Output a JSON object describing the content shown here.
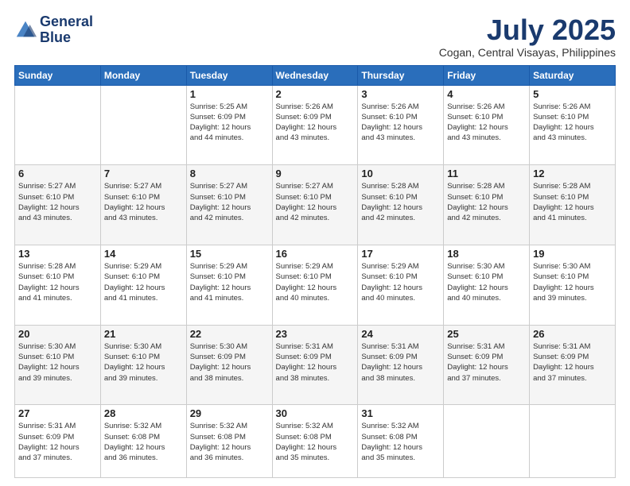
{
  "header": {
    "logo_line1": "General",
    "logo_line2": "Blue",
    "month_year": "July 2025",
    "location": "Cogan, Central Visayas, Philippines"
  },
  "days_of_week": [
    "Sunday",
    "Monday",
    "Tuesday",
    "Wednesday",
    "Thursday",
    "Friday",
    "Saturday"
  ],
  "weeks": [
    [
      {
        "num": "",
        "info": ""
      },
      {
        "num": "",
        "info": ""
      },
      {
        "num": "1",
        "info": "Sunrise: 5:25 AM\nSunset: 6:09 PM\nDaylight: 12 hours\nand 44 minutes."
      },
      {
        "num": "2",
        "info": "Sunrise: 5:26 AM\nSunset: 6:09 PM\nDaylight: 12 hours\nand 43 minutes."
      },
      {
        "num": "3",
        "info": "Sunrise: 5:26 AM\nSunset: 6:10 PM\nDaylight: 12 hours\nand 43 minutes."
      },
      {
        "num": "4",
        "info": "Sunrise: 5:26 AM\nSunset: 6:10 PM\nDaylight: 12 hours\nand 43 minutes."
      },
      {
        "num": "5",
        "info": "Sunrise: 5:26 AM\nSunset: 6:10 PM\nDaylight: 12 hours\nand 43 minutes."
      }
    ],
    [
      {
        "num": "6",
        "info": "Sunrise: 5:27 AM\nSunset: 6:10 PM\nDaylight: 12 hours\nand 43 minutes."
      },
      {
        "num": "7",
        "info": "Sunrise: 5:27 AM\nSunset: 6:10 PM\nDaylight: 12 hours\nand 43 minutes."
      },
      {
        "num": "8",
        "info": "Sunrise: 5:27 AM\nSunset: 6:10 PM\nDaylight: 12 hours\nand 42 minutes."
      },
      {
        "num": "9",
        "info": "Sunrise: 5:27 AM\nSunset: 6:10 PM\nDaylight: 12 hours\nand 42 minutes."
      },
      {
        "num": "10",
        "info": "Sunrise: 5:28 AM\nSunset: 6:10 PM\nDaylight: 12 hours\nand 42 minutes."
      },
      {
        "num": "11",
        "info": "Sunrise: 5:28 AM\nSunset: 6:10 PM\nDaylight: 12 hours\nand 42 minutes."
      },
      {
        "num": "12",
        "info": "Sunrise: 5:28 AM\nSunset: 6:10 PM\nDaylight: 12 hours\nand 41 minutes."
      }
    ],
    [
      {
        "num": "13",
        "info": "Sunrise: 5:28 AM\nSunset: 6:10 PM\nDaylight: 12 hours\nand 41 minutes."
      },
      {
        "num": "14",
        "info": "Sunrise: 5:29 AM\nSunset: 6:10 PM\nDaylight: 12 hours\nand 41 minutes."
      },
      {
        "num": "15",
        "info": "Sunrise: 5:29 AM\nSunset: 6:10 PM\nDaylight: 12 hours\nand 41 minutes."
      },
      {
        "num": "16",
        "info": "Sunrise: 5:29 AM\nSunset: 6:10 PM\nDaylight: 12 hours\nand 40 minutes."
      },
      {
        "num": "17",
        "info": "Sunrise: 5:29 AM\nSunset: 6:10 PM\nDaylight: 12 hours\nand 40 minutes."
      },
      {
        "num": "18",
        "info": "Sunrise: 5:30 AM\nSunset: 6:10 PM\nDaylight: 12 hours\nand 40 minutes."
      },
      {
        "num": "19",
        "info": "Sunrise: 5:30 AM\nSunset: 6:10 PM\nDaylight: 12 hours\nand 39 minutes."
      }
    ],
    [
      {
        "num": "20",
        "info": "Sunrise: 5:30 AM\nSunset: 6:10 PM\nDaylight: 12 hours\nand 39 minutes."
      },
      {
        "num": "21",
        "info": "Sunrise: 5:30 AM\nSunset: 6:10 PM\nDaylight: 12 hours\nand 39 minutes."
      },
      {
        "num": "22",
        "info": "Sunrise: 5:30 AM\nSunset: 6:09 PM\nDaylight: 12 hours\nand 38 minutes."
      },
      {
        "num": "23",
        "info": "Sunrise: 5:31 AM\nSunset: 6:09 PM\nDaylight: 12 hours\nand 38 minutes."
      },
      {
        "num": "24",
        "info": "Sunrise: 5:31 AM\nSunset: 6:09 PM\nDaylight: 12 hours\nand 38 minutes."
      },
      {
        "num": "25",
        "info": "Sunrise: 5:31 AM\nSunset: 6:09 PM\nDaylight: 12 hours\nand 37 minutes."
      },
      {
        "num": "26",
        "info": "Sunrise: 5:31 AM\nSunset: 6:09 PM\nDaylight: 12 hours\nand 37 minutes."
      }
    ],
    [
      {
        "num": "27",
        "info": "Sunrise: 5:31 AM\nSunset: 6:09 PM\nDaylight: 12 hours\nand 37 minutes."
      },
      {
        "num": "28",
        "info": "Sunrise: 5:32 AM\nSunset: 6:08 PM\nDaylight: 12 hours\nand 36 minutes."
      },
      {
        "num": "29",
        "info": "Sunrise: 5:32 AM\nSunset: 6:08 PM\nDaylight: 12 hours\nand 36 minutes."
      },
      {
        "num": "30",
        "info": "Sunrise: 5:32 AM\nSunset: 6:08 PM\nDaylight: 12 hours\nand 35 minutes."
      },
      {
        "num": "31",
        "info": "Sunrise: 5:32 AM\nSunset: 6:08 PM\nDaylight: 12 hours\nand 35 minutes."
      },
      {
        "num": "",
        "info": ""
      },
      {
        "num": "",
        "info": ""
      }
    ]
  ]
}
